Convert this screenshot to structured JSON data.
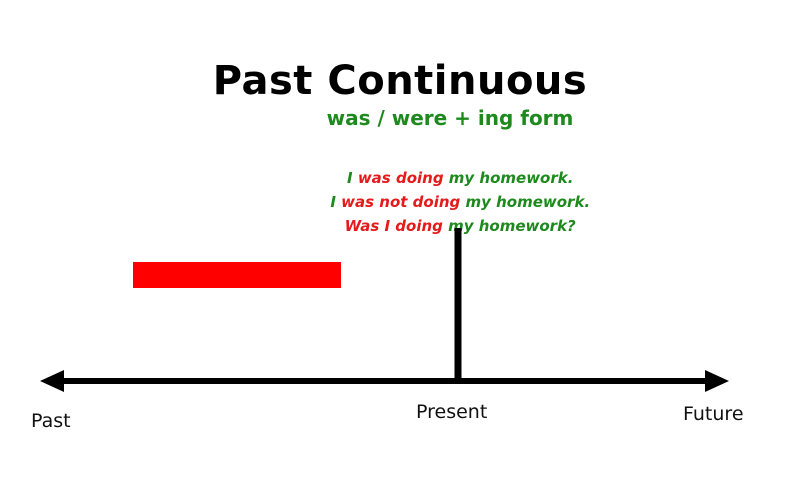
{
  "title": "Past Continuous",
  "formula": "was / were + ing form",
  "examples": [
    {
      "parts": [
        {
          "text": "I ",
          "color": "green"
        },
        {
          "text": "was doing",
          "color": "red"
        },
        {
          "text": " my homework.",
          "color": "green"
        }
      ]
    },
    {
      "parts": [
        {
          "text": "I ",
          "color": "green"
        },
        {
          "text": "was not doing",
          "color": "red"
        },
        {
          "text": " my homework.",
          "color": "green"
        }
      ]
    },
    {
      "parts": [
        {
          "text": "Was I doing",
          "color": "red"
        },
        {
          "text": " my homework?",
          "color": "green"
        }
      ]
    }
  ],
  "timeline": {
    "labels": {
      "past": "Past",
      "present": "Present",
      "future": "Future"
    }
  },
  "colors": {
    "green": "#1e8a1e",
    "red": "#e31b1b",
    "black": "#000000"
  }
}
